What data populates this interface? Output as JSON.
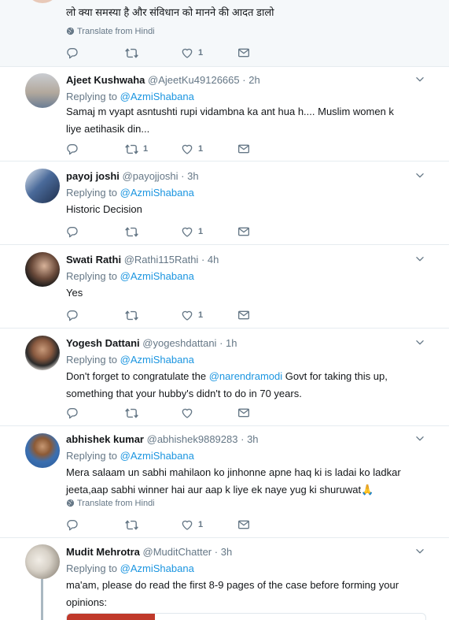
{
  "labels": {
    "replying_to": "Replying to",
    "translate": "Translate from Hindi",
    "dot": "·"
  },
  "top_tweet": {
    "text": "लो क्या समस्या है और संविधान को मानने की आदत डालो",
    "like_count": "1"
  },
  "tweets": [
    {
      "name": "Ajeet Kushwaha",
      "handle": "@AjeetKu49126665",
      "time": "2h",
      "replying_to": "@AzmiShabana",
      "text": "Samaj m vyapt asntushti rupi vidambna ka ant hua h.... Muslim women k liye aetihasik din...",
      "retweet_count": "1",
      "like_count": "1"
    },
    {
      "name": "payoj joshi",
      "handle": "@payojjoshi",
      "time": "3h",
      "replying_to": "@AzmiShabana",
      "text": "Historic Decision",
      "like_count": "1"
    },
    {
      "name": "Swati Rathi",
      "handle": "@Rathi115Rathi",
      "time": "4h",
      "replying_to": "@AzmiShabana",
      "text": "Yes",
      "like_count": "1"
    },
    {
      "name": "Yogesh Dattani",
      "handle": "@yogeshdattani",
      "time": "1h",
      "replying_to": "@AzmiShabana",
      "text_before": "Don't forget to congratulate the ",
      "mention": "@narendramodi",
      "text_after": " Govt for taking this up, something that your hubby's didn't to do in 70 years."
    },
    {
      "name": "abhishek kumar",
      "handle": "@abhishek9889283",
      "time": "3h",
      "replying_to": "@AzmiShabana",
      "text": "Mera salaam un sabhi mahilaon ko jinhonne apne haq ki is ladai ko ladkar jeeta,aap sabhi winner hai aur aap k liye ek naye yug ki shuruwat🙏",
      "like_count": "1"
    },
    {
      "name": "Mudit Mehrotra",
      "handle": "@MuditChatter",
      "time": "3h",
      "replying_to": "@AzmiShabana",
      "text": "ma'am, please do read the first 8-9 pages of the case before forming your opinions:"
    }
  ],
  "colors": {
    "link": "#1b95e0",
    "meta": "#657786",
    "divider": "#e6ecf0",
    "highlight_bg": "#f5f8fa"
  }
}
